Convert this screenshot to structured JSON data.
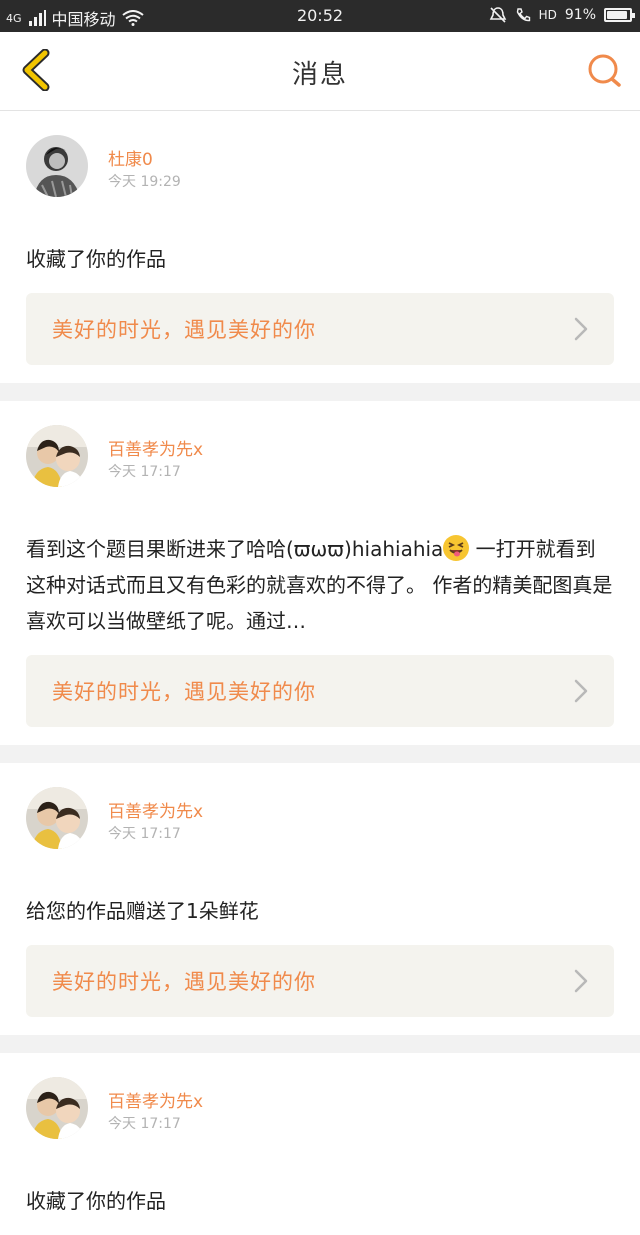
{
  "status_bar": {
    "network": "4G",
    "carrier": "中国移动",
    "time": "20:52",
    "hd_label": "HD",
    "battery": "91%",
    "battery_level": 0.91
  },
  "nav": {
    "title": "消息"
  },
  "colors": {
    "accent": "#f08a4b",
    "back_icon": "#f2c500"
  },
  "messages": [
    {
      "user_name": "杜康0",
      "time": "今天 19:29",
      "text": "收藏了你的作品",
      "source": "美好的时光，遇见美好的你"
    },
    {
      "user_name": "百善孝为先x",
      "time": "今天 17:17",
      "text": "看到这个题目果断进来了哈哈(ϖωϖ)hiahiahia",
      "text_after_emoji": " 一打开就看到这种对话式而且又有色彩的就喜欢的不得了。 作者的精美配图真是喜欢可以当做壁纸了呢。通过…",
      "source": "美好的时光，遇见美好的你"
    },
    {
      "user_name": "百善孝为先x",
      "time": "今天 17:17",
      "text": "给您的作品赠送了1朵鲜花",
      "source": "美好的时光，遇见美好的你"
    },
    {
      "user_name": "百善孝为先x",
      "time": "今天 17:17",
      "text": "收藏了你的作品"
    }
  ]
}
